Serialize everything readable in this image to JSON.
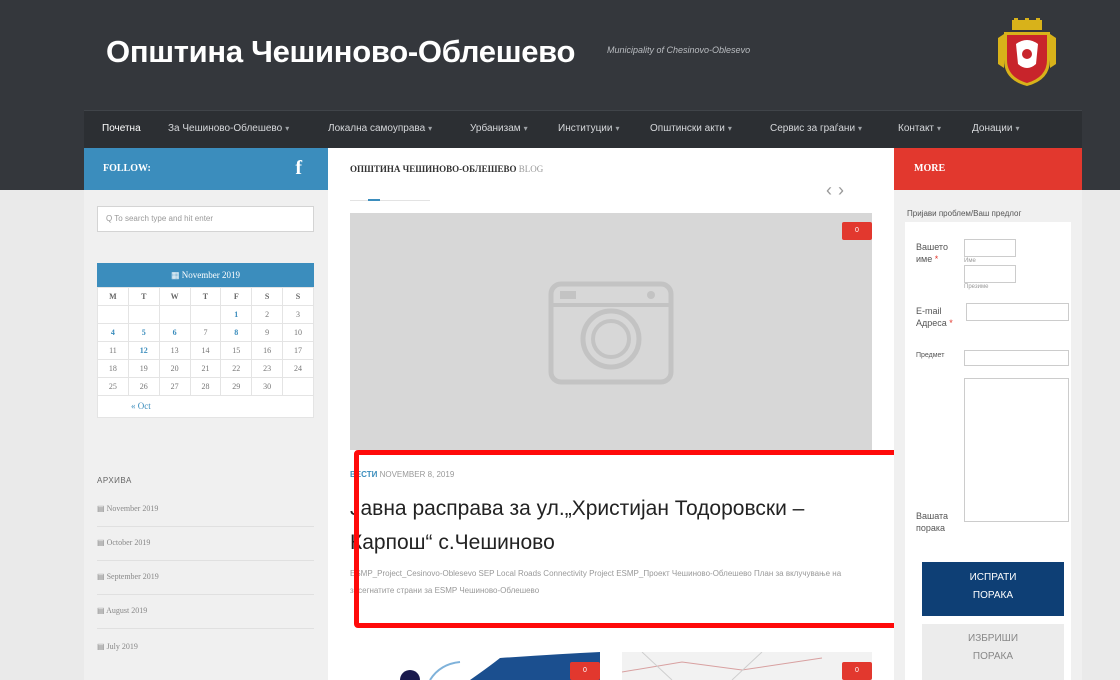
{
  "header": {
    "title": "Општина Чешиново-Облешево",
    "tagline": "Municipality of Chesinovo-Oblesevo"
  },
  "nav": {
    "items": [
      {
        "label": "Почетна",
        "dropdown": false
      },
      {
        "label": "За Чешиново-Облешево",
        "dropdown": true
      },
      {
        "label": "Локална самоуправа",
        "dropdown": true
      },
      {
        "label": "Урбанизам",
        "dropdown": true
      },
      {
        "label": "Институции",
        "dropdown": true
      },
      {
        "label": "Општински акти",
        "dropdown": true
      },
      {
        "label": "Сервис за граѓани",
        "dropdown": true
      },
      {
        "label": "Контакт",
        "dropdown": true
      },
      {
        "label": "Донации",
        "dropdown": true
      }
    ]
  },
  "left": {
    "follow_label": "FOLLOW:",
    "facebook_glyph": "f",
    "search_placeholder": "Q To search type and hit enter",
    "calendar": {
      "title": "November 2019",
      "weekdays": [
        "M",
        "T",
        "W",
        "T",
        "F",
        "S",
        "S"
      ],
      "weeks": [
        [
          "",
          "",
          "",
          "",
          "1",
          "2",
          "3"
        ],
        [
          "4",
          "5",
          "6",
          "7",
          "8",
          "9",
          "10"
        ],
        [
          "11",
          "12",
          "13",
          "14",
          "15",
          "16",
          "17"
        ],
        [
          "18",
          "19",
          "20",
          "21",
          "22",
          "23",
          "24"
        ],
        [
          "25",
          "26",
          "27",
          "28",
          "29",
          "30",
          ""
        ]
      ],
      "linked_days": [
        "1",
        "4",
        "5",
        "6",
        "8",
        "12"
      ],
      "prev_link": "« Oct"
    },
    "archive_title": "АРХИВА",
    "archive": [
      "November 2019",
      "October 2019",
      "September 2019",
      "August 2019",
      "July 2019"
    ]
  },
  "main": {
    "section_title": "ОПШТИНА ЧЕШИНОВО-ОБЛЕШЕВО",
    "section_suffix": "BLOG",
    "prev_arrow": "‹",
    "next_arrow": "›",
    "badge": "0",
    "post": {
      "category": "ВЕСТИ",
      "date": "NOVEMBER 8, 2019",
      "title": "Јавна расправа за ул.„Христијан Тодоровски – Карпош“ с.Чешиново",
      "excerpt": "ESMP_Project_Cesinovo-Oblesevo SEP Local Roads Connectivity Project ESMP_Проект Чешиново-Облешево План за вклучување на засегнатите страни за ESMP Чешиново-Облешево"
    },
    "thumb_badge_1": "0",
    "thumb_badge_2": "0"
  },
  "right": {
    "more_label": "MORE",
    "form_title": "Пријави проблем/Ваш предлог",
    "name_label": "Вашето име",
    "first_sub": "Име",
    "last_sub": "Презиме",
    "email_label": "E-mail Адреса",
    "subject_label": "Предмет",
    "message_label": "Вашата порака",
    "send_line1": "ИСПРАТИ",
    "send_line2": "ПОРАКА",
    "clear_line1": "ИЗБРИШИ",
    "clear_line2": "ПОРАКА"
  },
  "colors": {
    "accent_blue": "#3b8dbd",
    "accent_red": "#e2382e",
    "header_dark": "#34373c",
    "send_button": "#0e3f75",
    "highlight": "#ff0a0a"
  },
  "icons": [
    "facebook-icon",
    "search-icon",
    "calendar-icon",
    "camera-placeholder-icon",
    "chevron-left-icon",
    "chevron-right-icon",
    "comment-badge-icon",
    "municipality-crest-icon"
  ]
}
